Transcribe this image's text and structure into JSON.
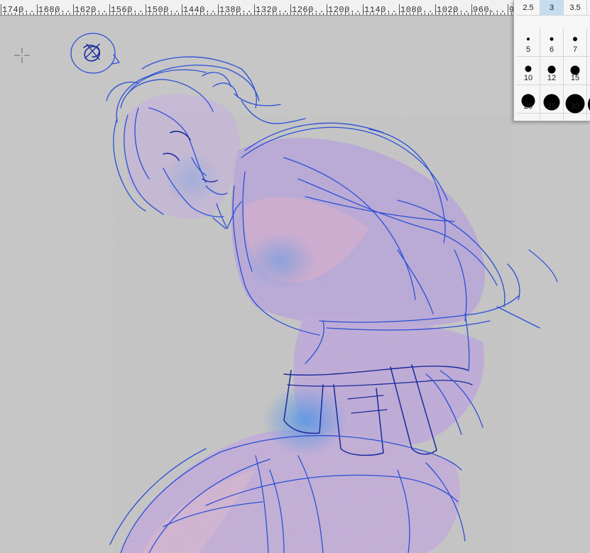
{
  "ruler": {
    "labels": [
      "1740",
      "1680",
      "1620",
      "1560",
      "1500",
      "1440",
      "1380",
      "1320",
      "1260",
      "1200",
      "1140",
      "1080",
      "1020",
      "960",
      "9"
    ]
  },
  "brush_sizes": {
    "selected": "3",
    "items": [
      {
        "label": "2.5",
        "dot": 0
      },
      {
        "label": "3",
        "dot": 0
      },
      {
        "label": "3.5",
        "dot": 0
      },
      {
        "label": "",
        "dot": 0
      },
      {
        "label": "5",
        "dot": 4
      },
      {
        "label": "6",
        "dot": 5
      },
      {
        "label": "7",
        "dot": 6
      },
      {
        "label": "",
        "dot": 0
      },
      {
        "label": "10",
        "dot": 9
      },
      {
        "label": "12",
        "dot": 11
      },
      {
        "label": "15",
        "dot": 13
      },
      {
        "label": "",
        "dot": 16
      },
      {
        "label": "20",
        "dot": 19
      },
      {
        "label": "25",
        "dot": 23
      },
      {
        "label": "30",
        "dot": 27
      },
      {
        "label": "",
        "dot": 30
      },
      {
        "label": "",
        "dot": 34
      },
      {
        "label": "",
        "dot": 38
      },
      {
        "label": "",
        "dot": 42
      },
      {
        "label": "",
        "dot": 46
      }
    ]
  },
  "colors": {
    "canvas_bg": "#c6c6c6",
    "line_blue": "#2b4fd6",
    "line_dark": "#1a2a9a",
    "shade_lavender": "#b8a6dc",
    "shade_pink": "#d5b4d8",
    "shade_blue": "#4f8be8"
  }
}
